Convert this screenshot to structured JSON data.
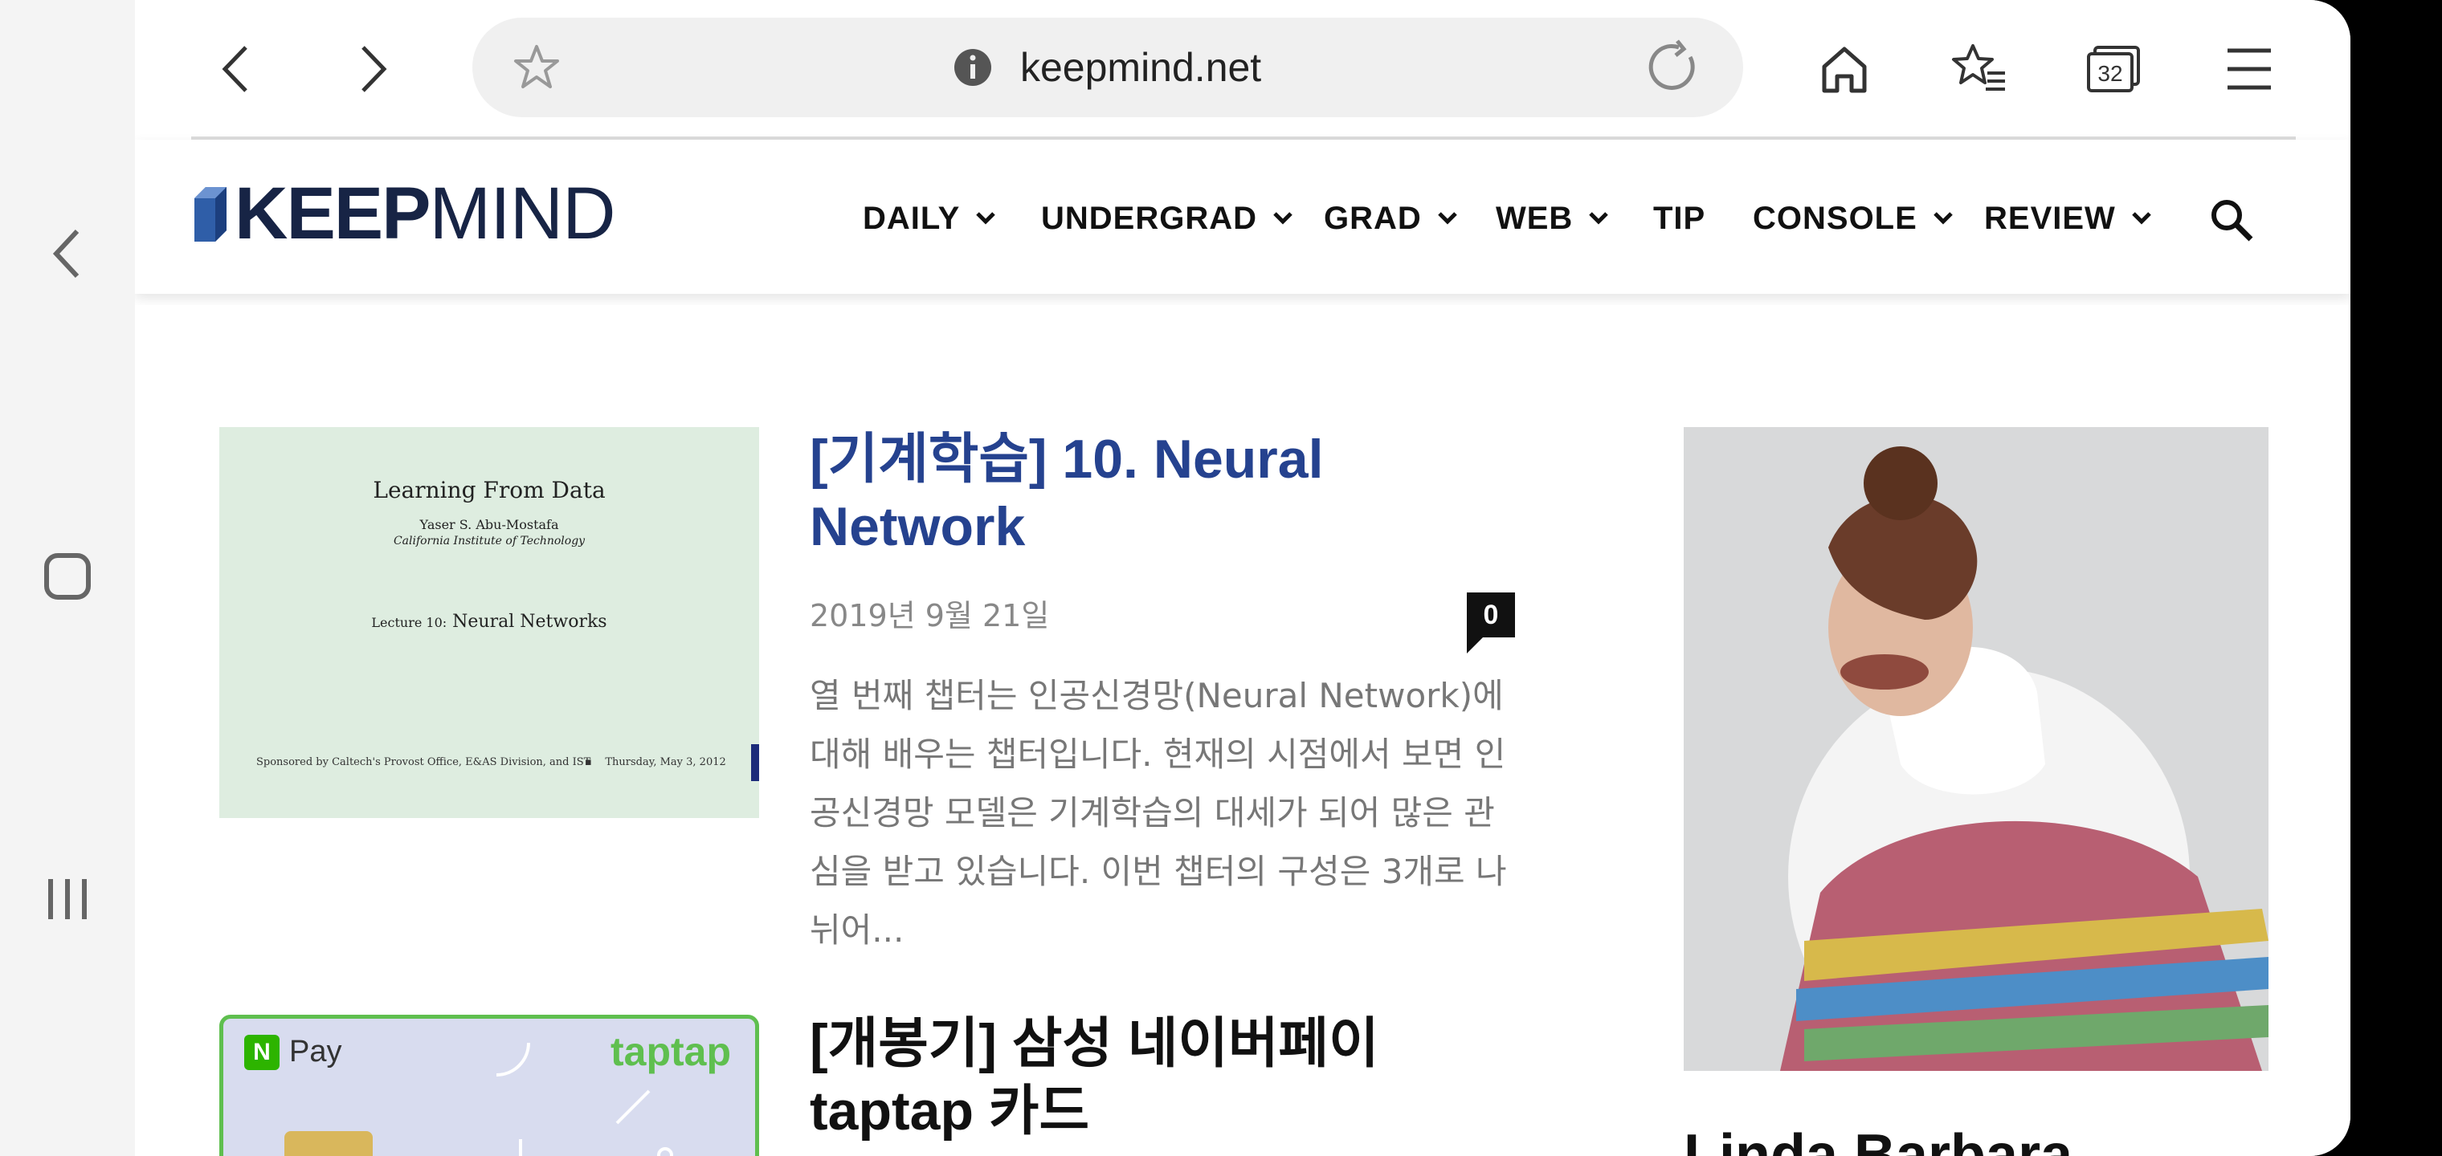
{
  "browser": {
    "url": "keepmind.net",
    "tab_count": "32"
  },
  "site": {
    "logo_bold": "KEEP",
    "logo_light": "MIND",
    "nav": [
      {
        "label": "DAILY",
        "has_dropdown": true
      },
      {
        "label": "UNDERGRAD",
        "has_dropdown": true
      },
      {
        "label": "GRAD",
        "has_dropdown": true
      },
      {
        "label": "WEB",
        "has_dropdown": true
      },
      {
        "label": "TIP",
        "has_dropdown": false
      },
      {
        "label": "CONSOLE",
        "has_dropdown": true
      },
      {
        "label": "REVIEW",
        "has_dropdown": true
      }
    ]
  },
  "posts": [
    {
      "title": "[기계학습] 10. Neural Network",
      "date": "2019년 9월 21일",
      "comments": "0",
      "excerpt": "열 번째 챕터는 인공신경망(Neural Network)에 대해 배우는 챕터입니다. 현재의 시점에서 보면 인공신경망 모델은 기계학습의 대세가 되어 많은 관심을 받고 있습니다. 이번 챕터의 구성은 3개로 나뉘어...",
      "thumb": {
        "heading": "Learning From Data",
        "author": "Yaser S. Abu-Mostafa",
        "affiliation": "California Institute of Technology",
        "lecture_prefix": "Lecture 10:",
        "lecture_title": "Neural Networks",
        "sponsor": "Sponsored by Caltech's Provost Office, E&AS Division, and IST",
        "thumb_date": "Thursday, May 3, 2012"
      }
    },
    {
      "title": "[개봉기] 삼성 네이버페이 taptap 카드",
      "thumb": {
        "pay_label": "Pay",
        "brand": "taptap"
      }
    }
  ],
  "sidebar": {
    "name": "Linda Barbara"
  },
  "colors": {
    "logo": "#172445",
    "post_title": "#25428f",
    "accent_green": "#5fbf4f"
  }
}
